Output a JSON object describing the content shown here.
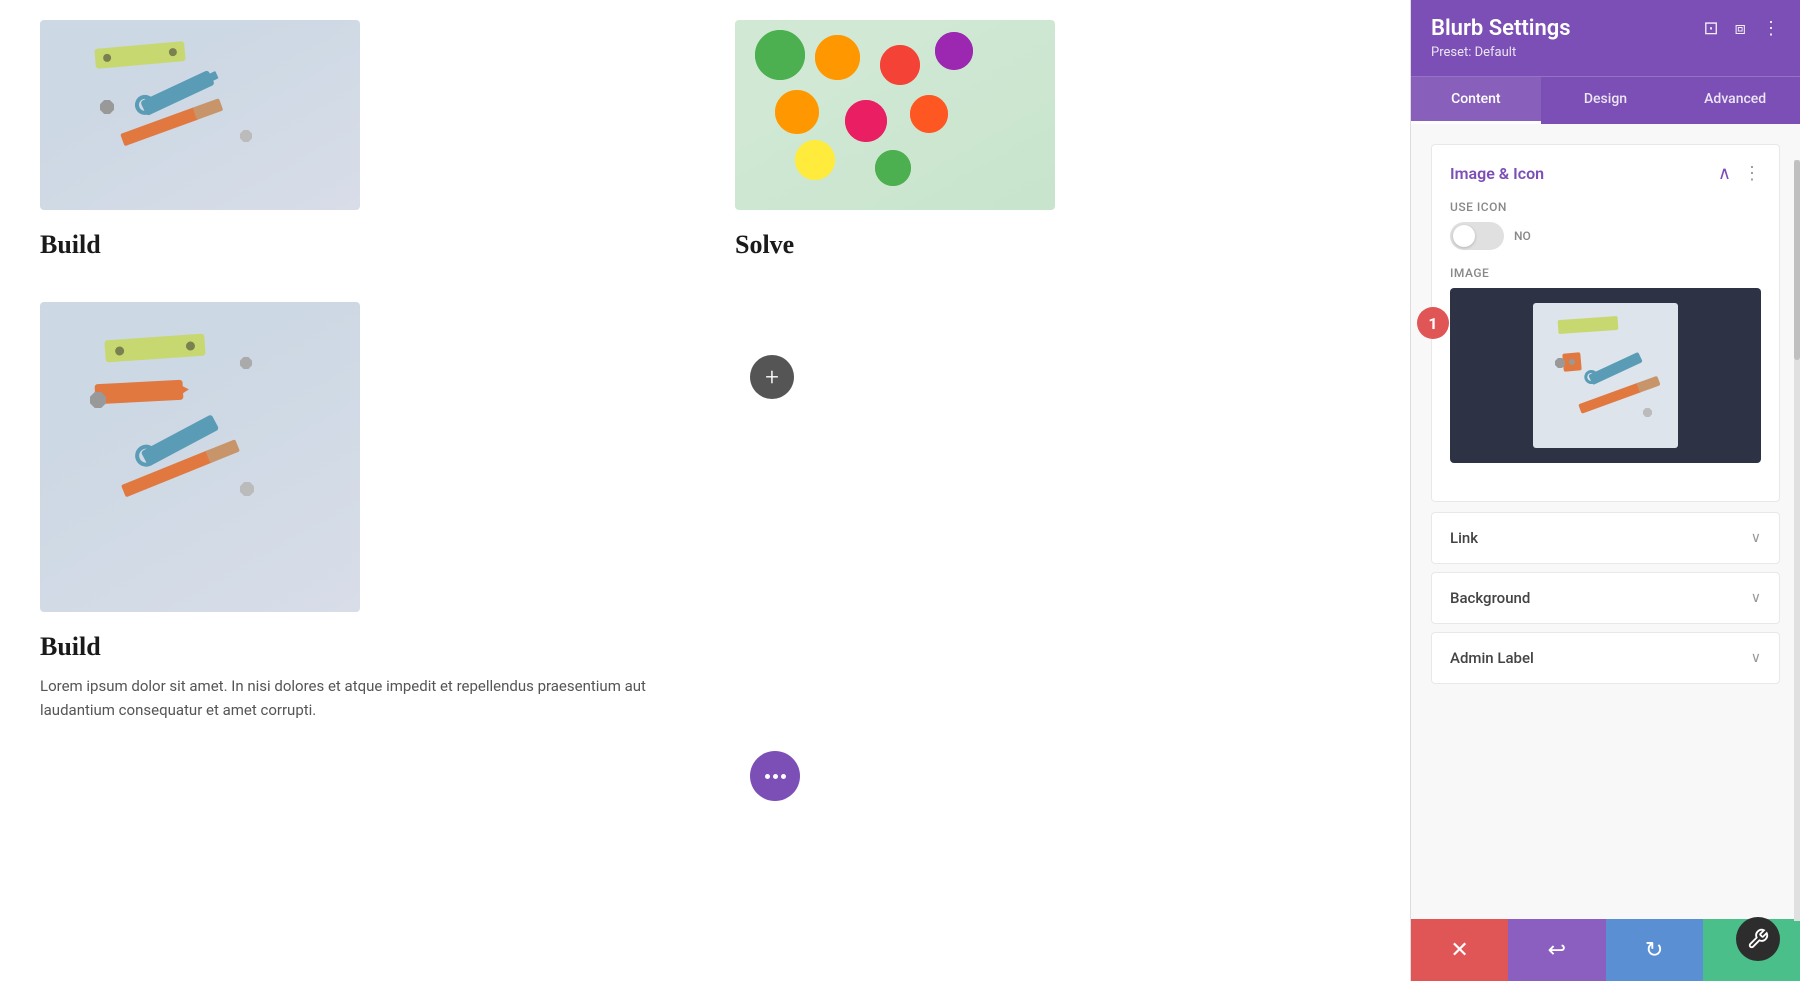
{
  "page": {
    "title": "Blurb Settings",
    "preset": "Preset: Default"
  },
  "tabs": {
    "content": "Content",
    "design": "Design",
    "advanced": "Advanced",
    "active": "content"
  },
  "sections": {
    "image_icon": {
      "label": "Image & Icon",
      "use_icon": {
        "label": "Use Icon",
        "value": "NO"
      },
      "image_label": "Image"
    },
    "link": {
      "label": "Link"
    },
    "background": {
      "label": "Background"
    },
    "admin_label": {
      "label": "Admin Label"
    }
  },
  "blurbs": [
    {
      "title": "Build",
      "text": "",
      "position": "top-left"
    },
    {
      "title": "Solve",
      "text": "",
      "position": "top-right"
    },
    {
      "title": "Build",
      "text": "Lorem ipsum dolor sit amet. In nisi dolores et atque impedit et repellendus praesentium aut laudantium consequatur et amet corrupti.",
      "position": "bottom-left"
    }
  ],
  "footer": {
    "cancel": "×",
    "undo": "↩",
    "redo": "↻",
    "save": "✓"
  },
  "badge": "1",
  "add_button": "+",
  "more_dots": [
    "•",
    "•",
    "•"
  ]
}
